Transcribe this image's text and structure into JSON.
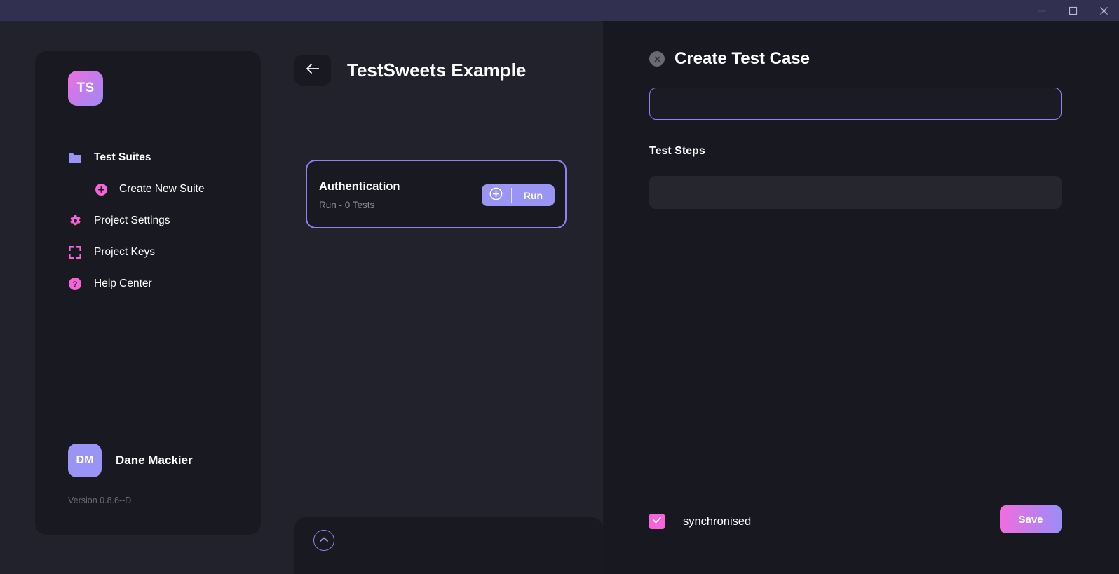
{
  "window": {
    "minimize_label": "Minimize",
    "maximize_label": "Maximize",
    "close_label": "Close"
  },
  "sidebar": {
    "logo_text": "TS",
    "items": [
      {
        "label": "Test Suites",
        "icon": "folder-icon"
      },
      {
        "label": "Create New Suite",
        "icon": "plus-circle-icon"
      },
      {
        "label": "Project Settings",
        "icon": "gear-icon"
      },
      {
        "label": "Project Keys",
        "icon": "keys-icon"
      },
      {
        "label": "Help Center",
        "icon": "question-circle-icon"
      }
    ],
    "user": {
      "initials": "DM",
      "name": "Dane Mackier"
    },
    "version": "Version 0.8.6--D"
  },
  "center": {
    "back_icon": "arrow-left-icon",
    "title": "TestSweets Example",
    "suite": {
      "name": "Authentication",
      "subtitle": "Run - 0 Tests",
      "run_label": "Run",
      "add_icon": "plus-circle-icon"
    },
    "collapse_icon": "chevron-up-icon"
  },
  "right_panel": {
    "close_icon": "close-circle-icon",
    "title": "Create Test Case",
    "name_input": {
      "value": "",
      "placeholder": ""
    },
    "steps_label": "Test Steps",
    "steps_items": [],
    "sync": {
      "label": "synchronised",
      "checked": true
    },
    "save_label": "Save"
  },
  "colors": {
    "titlebar": "#313050",
    "page_bg": "#22222c",
    "panel_bg": "#181821",
    "card_bg": "#191921",
    "accent_purple": "#8d82ef",
    "accent_periwinkle": "#9a94f5",
    "accent_pink": "#f763d8",
    "muted_text": "#8b8b98"
  }
}
